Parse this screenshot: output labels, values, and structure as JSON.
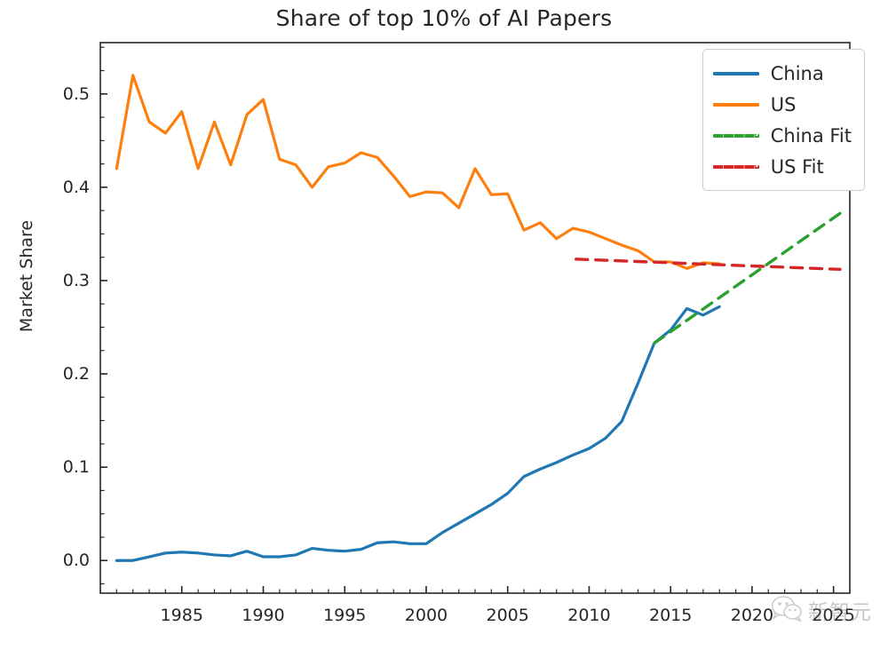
{
  "chart_data": {
    "type": "line",
    "title": "Share of top 10% of AI Papers",
    "xlabel": "",
    "ylabel": "Market Share",
    "xlim": [
      1980.0,
      2026.0
    ],
    "ylim": [
      -0.035,
      0.555
    ],
    "xticks": [
      1985,
      1990,
      1995,
      2000,
      2005,
      2010,
      2015,
      2020,
      2025
    ],
    "xtick_labels": [
      "1985",
      "1990",
      "1995",
      "2000",
      "2005",
      "2010",
      "2015",
      "2020",
      "2025"
    ],
    "yticks": [
      0.0,
      0.1,
      0.2,
      0.3,
      0.4,
      0.5
    ],
    "ytick_labels": [
      "0.0",
      "0.1",
      "0.2",
      "0.3",
      "0.4",
      "0.5"
    ],
    "minor_xtick_step": 1,
    "minor_ytick_step": 0.025,
    "grid": false,
    "legend_position": "upper right",
    "legend_entries": [
      "China",
      "US",
      "China Fit",
      "US Fit"
    ],
    "colors": {
      "china": "#1f77b4",
      "us": "#ff7f0e",
      "china_fit": "#2ca02c",
      "us_fit": "#d62728",
      "axis": "#262626",
      "text": "#262626"
    },
    "series": [
      {
        "name": "China",
        "style": "solid",
        "color": "#1f77b4",
        "x": [
          1981,
          1982,
          1983,
          1984,
          1985,
          1986,
          1987,
          1988,
          1989,
          1990,
          1991,
          1992,
          1993,
          1994,
          1995,
          1996,
          1997,
          1998,
          1999,
          2000,
          2001,
          2002,
          2003,
          2004,
          2005,
          2006,
          2007,
          2008,
          2009,
          2010,
          2011,
          2012,
          2013,
          2014,
          2015,
          2016,
          2017,
          2018
        ],
        "y": [
          0.0,
          0.0,
          0.004,
          0.008,
          0.009,
          0.008,
          0.006,
          0.005,
          0.01,
          0.004,
          0.004,
          0.006,
          0.013,
          0.011,
          0.01,
          0.012,
          0.019,
          0.02,
          0.018,
          0.018,
          0.03,
          0.04,
          0.05,
          0.06,
          0.072,
          0.09,
          0.098,
          0.105,
          0.113,
          0.12,
          0.131,
          0.149,
          0.19,
          0.233,
          0.247,
          0.27,
          0.263,
          0.272
        ]
      },
      {
        "name": "US",
        "style": "solid",
        "color": "#ff7f0e",
        "x": [
          1981,
          1982,
          1983,
          1984,
          1985,
          1986,
          1987,
          1988,
          1989,
          1990,
          1991,
          1992,
          1993,
          1994,
          1995,
          1996,
          1997,
          1998,
          1999,
          2000,
          2001,
          2002,
          2003,
          2004,
          2005,
          2006,
          2007,
          2008,
          2009,
          2010,
          2011,
          2012,
          2013,
          2014,
          2015,
          2016,
          2017,
          2018
        ],
        "y": [
          0.42,
          0.52,
          0.47,
          0.458,
          0.481,
          0.42,
          0.47,
          0.424,
          0.478,
          0.494,
          0.43,
          0.424,
          0.4,
          0.422,
          0.426,
          0.437,
          0.432,
          0.412,
          0.39,
          0.395,
          0.394,
          0.378,
          0.42,
          0.392,
          0.393,
          0.354,
          0.362,
          0.345,
          0.356,
          0.352,
          0.345,
          0.338,
          0.332,
          0.32,
          0.32,
          0.313,
          0.319,
          0.318
        ]
      },
      {
        "name": "China Fit",
        "style": "dashed",
        "color": "#2ca02c",
        "x": [
          2014,
          2025.4
        ],
        "y": [
          0.233,
          0.372
        ]
      },
      {
        "name": "US Fit",
        "style": "dashed",
        "color": "#d62728",
        "x": [
          2009.2,
          2025.4
        ],
        "y": [
          0.323,
          0.312
        ]
      }
    ],
    "annotations": {
      "fit_crossover": {
        "x": 2020.5,
        "y": 0.317
      }
    }
  },
  "watermark": {
    "text": "新智元",
    "icon": "wechat-icon"
  }
}
